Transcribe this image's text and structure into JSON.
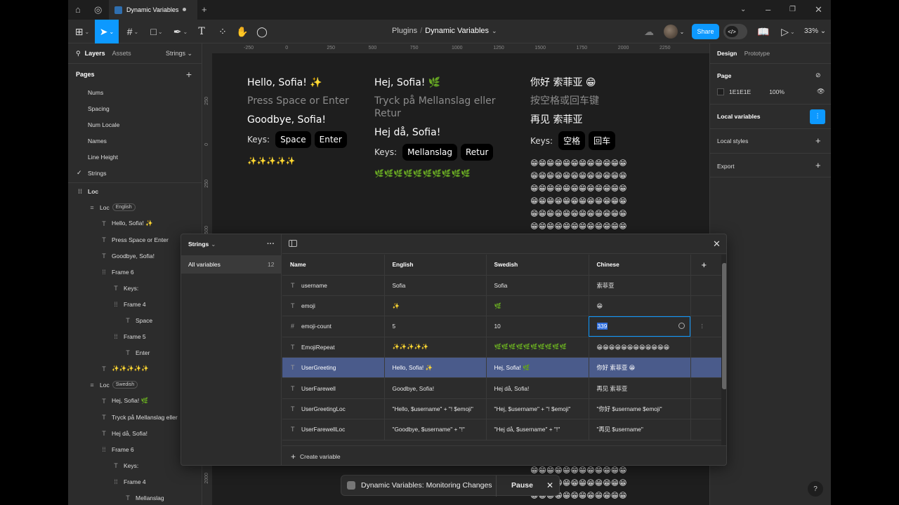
{
  "tab": {
    "title": "Dynamic Variables"
  },
  "toolbar": {
    "breadcrumb_parent": "Plugins",
    "breadcrumb_current": "Dynamic Variables",
    "share_label": "Share",
    "zoom": "33%"
  },
  "left": {
    "tabs": {
      "layers": "Layers",
      "assets": "Assets",
      "page_switch": "Strings"
    },
    "pages_title": "Pages",
    "pages": [
      "Nums",
      "Spacing",
      "Num Locale",
      "Names",
      "Line Height",
      "Strings"
    ],
    "layers": [
      {
        "label": "Loc",
        "icon": "frame-icon",
        "indent": 0,
        "bold": true
      },
      {
        "label": "Loc",
        "icon": "auto-layout-icon",
        "indent": 1,
        "badge": "English"
      },
      {
        "label": "Hello, Sofia! ✨",
        "icon": "text-icon",
        "indent": 2
      },
      {
        "label": "Press Space or Enter",
        "icon": "text-icon",
        "indent": 2
      },
      {
        "label": "Goodbye, Sofia!",
        "icon": "text-icon",
        "indent": 2
      },
      {
        "label": "Frame 6",
        "icon": "frame-icon",
        "indent": 2
      },
      {
        "label": "Keys:",
        "icon": "text-icon",
        "indent": 3
      },
      {
        "label": "Frame 4",
        "icon": "frame-icon",
        "indent": 3
      },
      {
        "label": "Space",
        "icon": "text-icon",
        "indent": 4
      },
      {
        "label": "Frame 5",
        "icon": "frame-icon",
        "indent": 3
      },
      {
        "label": "Enter",
        "icon": "text-icon",
        "indent": 4
      },
      {
        "label": "✨✨✨✨✨",
        "icon": "text-icon",
        "indent": 2
      },
      {
        "label": "Loc",
        "icon": "auto-layout-icon",
        "indent": 1,
        "badge": "Swedish"
      },
      {
        "label": "Hej, Sofia! 🌿",
        "icon": "text-icon",
        "indent": 2
      },
      {
        "label": "Tryck på Mellanslag eller",
        "icon": "text-icon",
        "indent": 2
      },
      {
        "label": "Hej då, Sofia!",
        "icon": "text-icon",
        "indent": 2
      },
      {
        "label": "Frame 6",
        "icon": "frame-icon",
        "indent": 2
      },
      {
        "label": "Keys:",
        "icon": "text-icon",
        "indent": 3
      },
      {
        "label": "Frame 4",
        "icon": "frame-icon",
        "indent": 3
      },
      {
        "label": "Mellanslag",
        "icon": "text-icon",
        "indent": 4
      }
    ]
  },
  "canvas": {
    "ruler_top": [
      "-250",
      "0",
      "250",
      "500",
      "750",
      "1000",
      "1250",
      "1500",
      "1750",
      "2000",
      "2250"
    ],
    "ruler_left": [
      "250",
      "0",
      "250",
      "500",
      "2000"
    ],
    "english": {
      "hello": "Hello, Sofia! ✨",
      "press": "Press Space or Enter",
      "goodbye": "Goodbye, Sofia!",
      "keys": "Keys:",
      "k1": "Space",
      "k2": "Enter",
      "emoji": "✨✨✨✨✨"
    },
    "swedish": {
      "hello": "Hej, Sofia! 🌿",
      "press1": "Tryck på Mellanslag eller",
      "press2": "Retur",
      "goodbye": "Hej då, Sofia!",
      "keys": "Keys:",
      "k1": "Mellanslag",
      "k2": "Retur",
      "emoji": "🌿🌿🌿🌿🌿🌿🌿🌿🌿🌿"
    },
    "chinese": {
      "hello": "你好 索菲亚 😁",
      "press": "按空格或回车键",
      "goodbye": "再见 索菲亚",
      "keys": "Keys:",
      "k1": "空格",
      "k2": "回车",
      "emoji_row": "😁😁😁😁😁😁😁😁😁😁😁😁",
      "emoji_rows": 6
    }
  },
  "toast": {
    "label": "Dynamic Variables: Monitoring Changes",
    "pause": "Pause"
  },
  "right": {
    "tabs": {
      "design": "Design",
      "prototype": "Prototype"
    },
    "page_label": "Page",
    "page_color": "1E1E1E",
    "page_opacity": "100%",
    "local_variables": "Local variables",
    "local_styles": "Local styles",
    "export": "Export"
  },
  "modal": {
    "collection": "Strings",
    "all_label": "All variables",
    "all_count": "12",
    "headers": [
      "Name",
      "English",
      "Swedish",
      "Chinese"
    ],
    "rows": [
      {
        "type": "T",
        "name": "username",
        "en": "Sofia",
        "sv": "Sofia",
        "zh": "索菲亚"
      },
      {
        "type": "T",
        "name": "emoji",
        "en": "✨",
        "sv": "🌿",
        "zh": "😁"
      },
      {
        "type": "#",
        "name": "emoji-count",
        "en": "5",
        "sv": "10",
        "zh": "339"
      },
      {
        "type": "T",
        "name": "EmojiRepeat",
        "en": "✨✨✨✨✨",
        "sv": "🌿🌿🌿🌿🌿🌿🌿🌿🌿🌿",
        "zh": "😁😁😁😁😁😁😁😁😁😁😁😁"
      },
      {
        "type": "T",
        "name": "UserGreeting",
        "en": "Hello, Sofia! ✨",
        "sv": "Hej, Sofia! 🌿",
        "zh": "你好 索菲亚 😁"
      },
      {
        "type": "T",
        "name": "UserFarewell",
        "en": "Goodbye, Sofia!",
        "sv": "Hej då, Sofia!",
        "zh": "再见 索菲亚"
      },
      {
        "type": "T",
        "name": "UserGreetingLoc",
        "en": "\"Hello, $username\" + \"! $emoji\"",
        "sv": "\"Hej, $username\" + \"! $emoji\"",
        "zh": "\"你好 $username $emoji\""
      },
      {
        "type": "T",
        "name": "UserFarewellLoc",
        "en": "\"Goodbye, $username\" + \"!\"",
        "sv": "\"Hej då, $username\" + \"!\"",
        "zh": "\"再见 $username\""
      }
    ],
    "create_label": "Create variable"
  }
}
